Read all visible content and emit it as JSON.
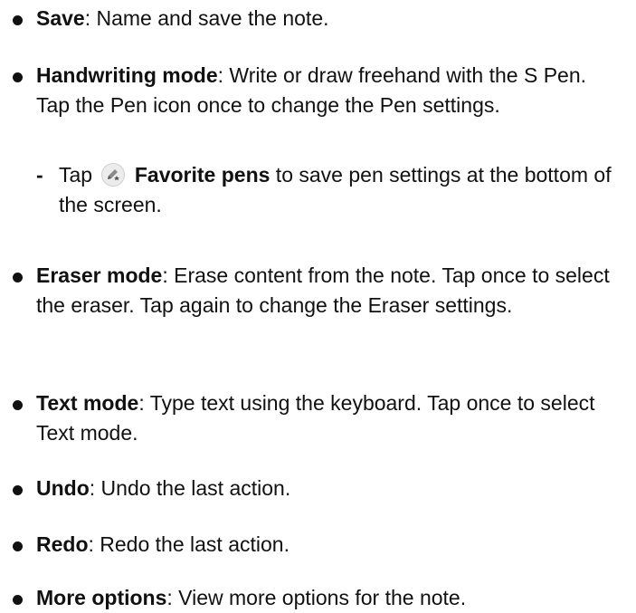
{
  "items": [
    {
      "term": "Save",
      "desc": ": Name and save the note."
    },
    {
      "term": "Handwriting mode",
      "desc": ": Write or draw freehand with the S Pen. Tap the Pen icon once to change the Pen settings."
    },
    {
      "sub_before": "Tap",
      "sub_icon": "favorite-pens-icon",
      "sub_term": "Favorite pens",
      "sub_after": " to save pen settings at the bottom of the screen."
    },
    {
      "term": "Eraser mode",
      "desc": ": Erase content from the note. Tap once to select the eraser. Tap again to change the Eraser settings."
    },
    {
      "term": "Text mode",
      "desc": ": Type text using the keyboard. Tap once to select Text mode."
    },
    {
      "term": "Undo",
      "desc": ": Undo the last action."
    },
    {
      "term": "Redo",
      "desc": ": Redo the last action."
    },
    {
      "term": "More options",
      "desc": ": View more options for the note."
    }
  ],
  "sub_dash": "-"
}
